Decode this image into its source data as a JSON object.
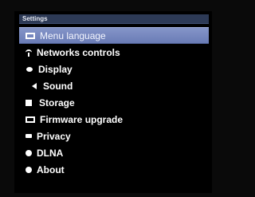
{
  "header": {
    "title": "Settings"
  },
  "menu": {
    "items": [
      {
        "label": "Menu language",
        "icon": "language-icon",
        "selected": true
      },
      {
        "label": "Networks controls",
        "icon": "network-icon",
        "selected": false
      },
      {
        "label": "Display",
        "icon": "display-icon",
        "selected": false
      },
      {
        "label": "Sound",
        "icon": "speaker-icon",
        "selected": false
      },
      {
        "label": "Storage",
        "icon": "storage-icon",
        "selected": false
      },
      {
        "label": "Firmware upgrade",
        "icon": "firmware-icon",
        "selected": false
      },
      {
        "label": "Privacy",
        "icon": "privacy-icon",
        "selected": false
      },
      {
        "label": "DLNA",
        "icon": "dlna-icon",
        "selected": false
      },
      {
        "label": "About",
        "icon": "info-icon",
        "selected": false
      }
    ]
  },
  "colors": {
    "background": "#000000",
    "header": "#2d3a56",
    "selected": "#6b7fb8",
    "text": "#ffffff"
  }
}
